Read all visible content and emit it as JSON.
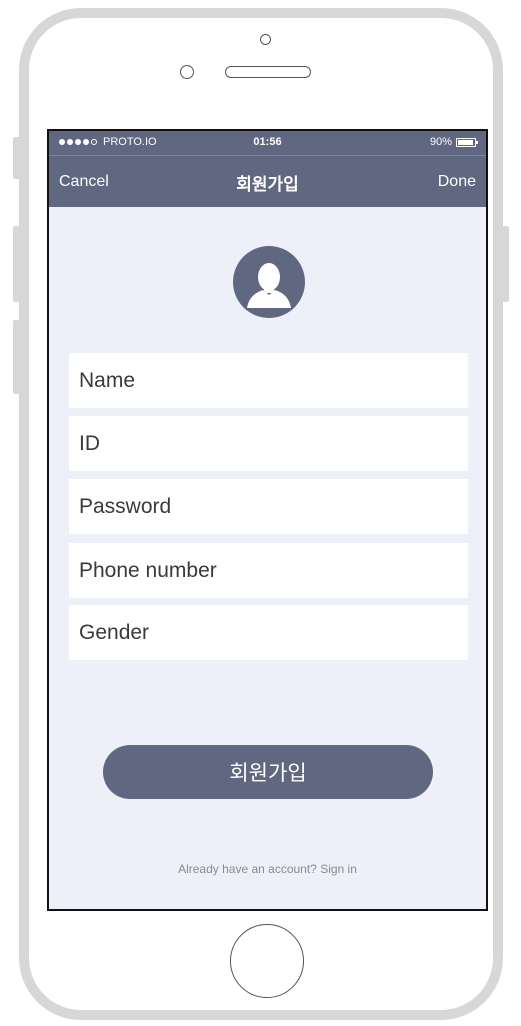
{
  "status_bar": {
    "carrier": "PROTO.IO",
    "time": "01:56",
    "battery": "90%",
    "signal_icon": "signal-dots-icon",
    "battery_icon": "battery-icon"
  },
  "nav": {
    "left_label": "Cancel",
    "title": "회원가입",
    "right_label": "Done"
  },
  "avatar_icon": "user-silhouette-icon",
  "form": {
    "name_placeholder": "Name",
    "id_placeholder": "ID",
    "password_placeholder": "Password",
    "phone_placeholder": "Phone number",
    "gender_placeholder": "Gender"
  },
  "signup_button_label": "회원가입",
  "signin_link": "Already have an account? Sign in",
  "colors": {
    "accent": "#5f6781",
    "background": "#edf0f8",
    "field": "#ffffff",
    "frame": "#d7d7d7"
  }
}
